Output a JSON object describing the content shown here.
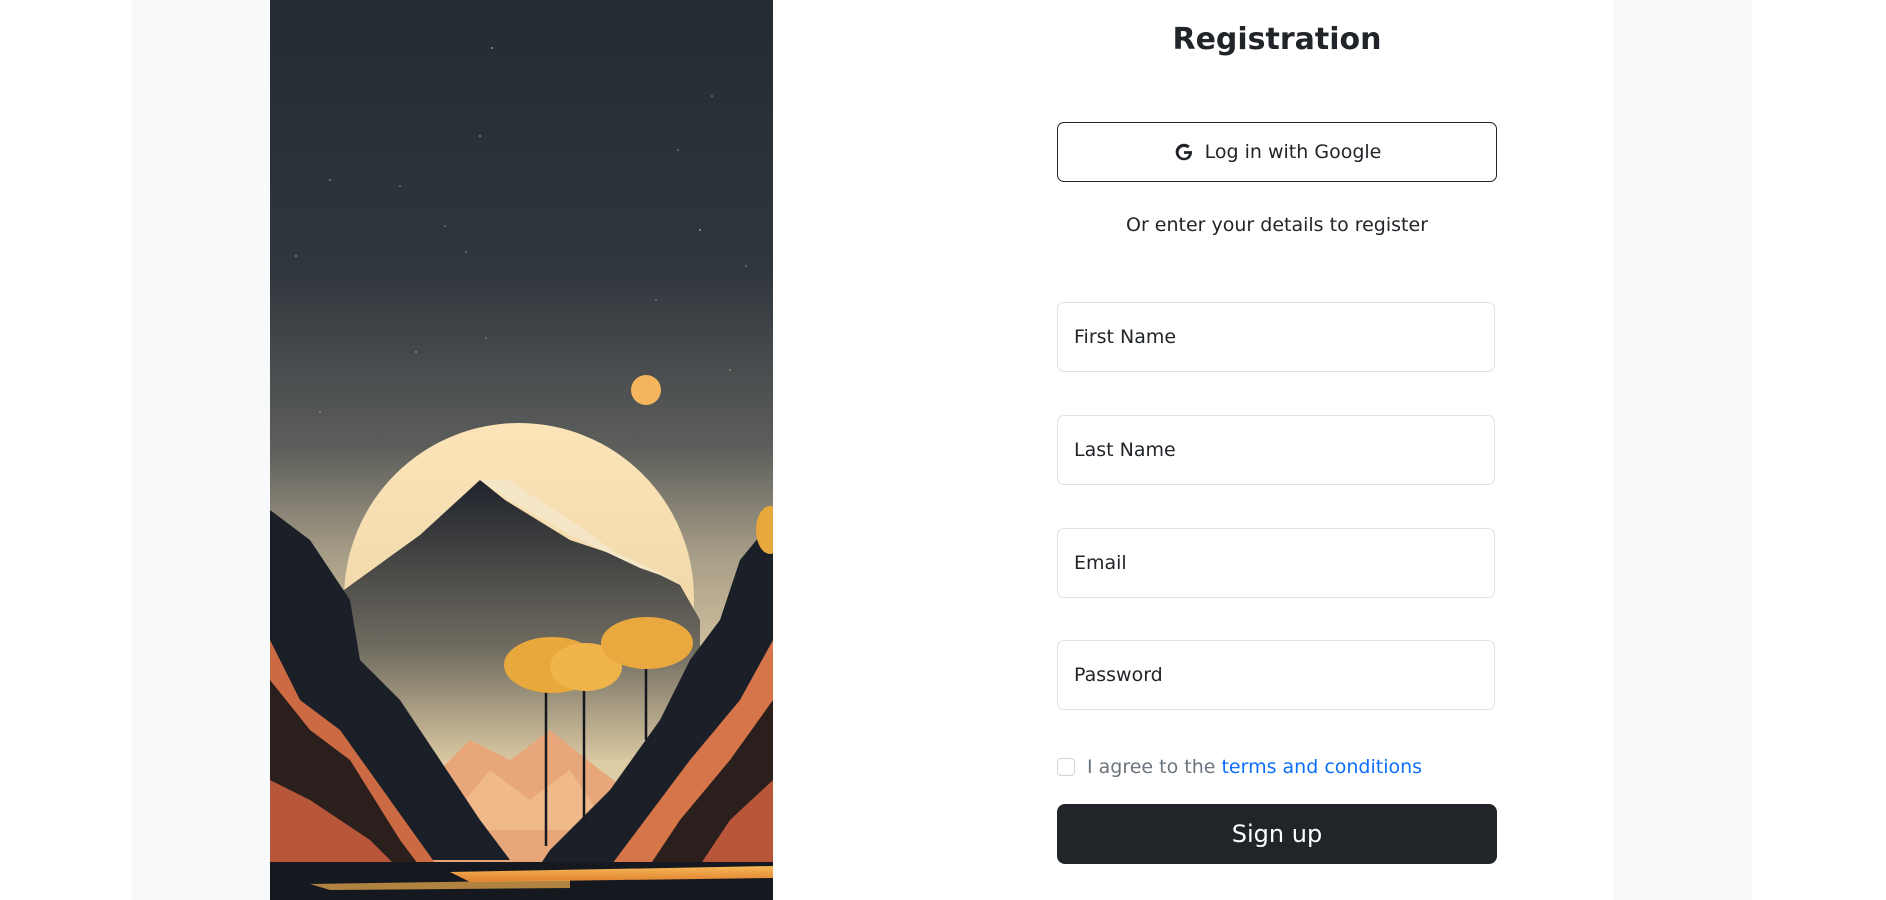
{
  "registration": {
    "title": "Registration",
    "google_button_label": "Log in with Google",
    "google_icon": "google-g-icon",
    "divider_text": "Or enter your details to register",
    "fields": [
      {
        "name": "first-name",
        "placeholder": "First Name",
        "value": ""
      },
      {
        "name": "last-name",
        "placeholder": "Last Name",
        "value": ""
      },
      {
        "name": "email",
        "placeholder": "Email",
        "value": ""
      },
      {
        "name": "password",
        "placeholder": "Password",
        "value": ""
      }
    ],
    "terms_prefix": "I agree to the",
    "terms_link": "terms and conditions",
    "terms_checked": false,
    "signup_label": "Sign up"
  },
  "illustration": {
    "alt": "mountain-landscape-illustration"
  },
  "colors": {
    "primary_dark": "#212529",
    "link": "#0d6efd",
    "muted_text": "#6c757d",
    "field_border": "#dee2e6",
    "page_background": "#f8f9fa"
  }
}
